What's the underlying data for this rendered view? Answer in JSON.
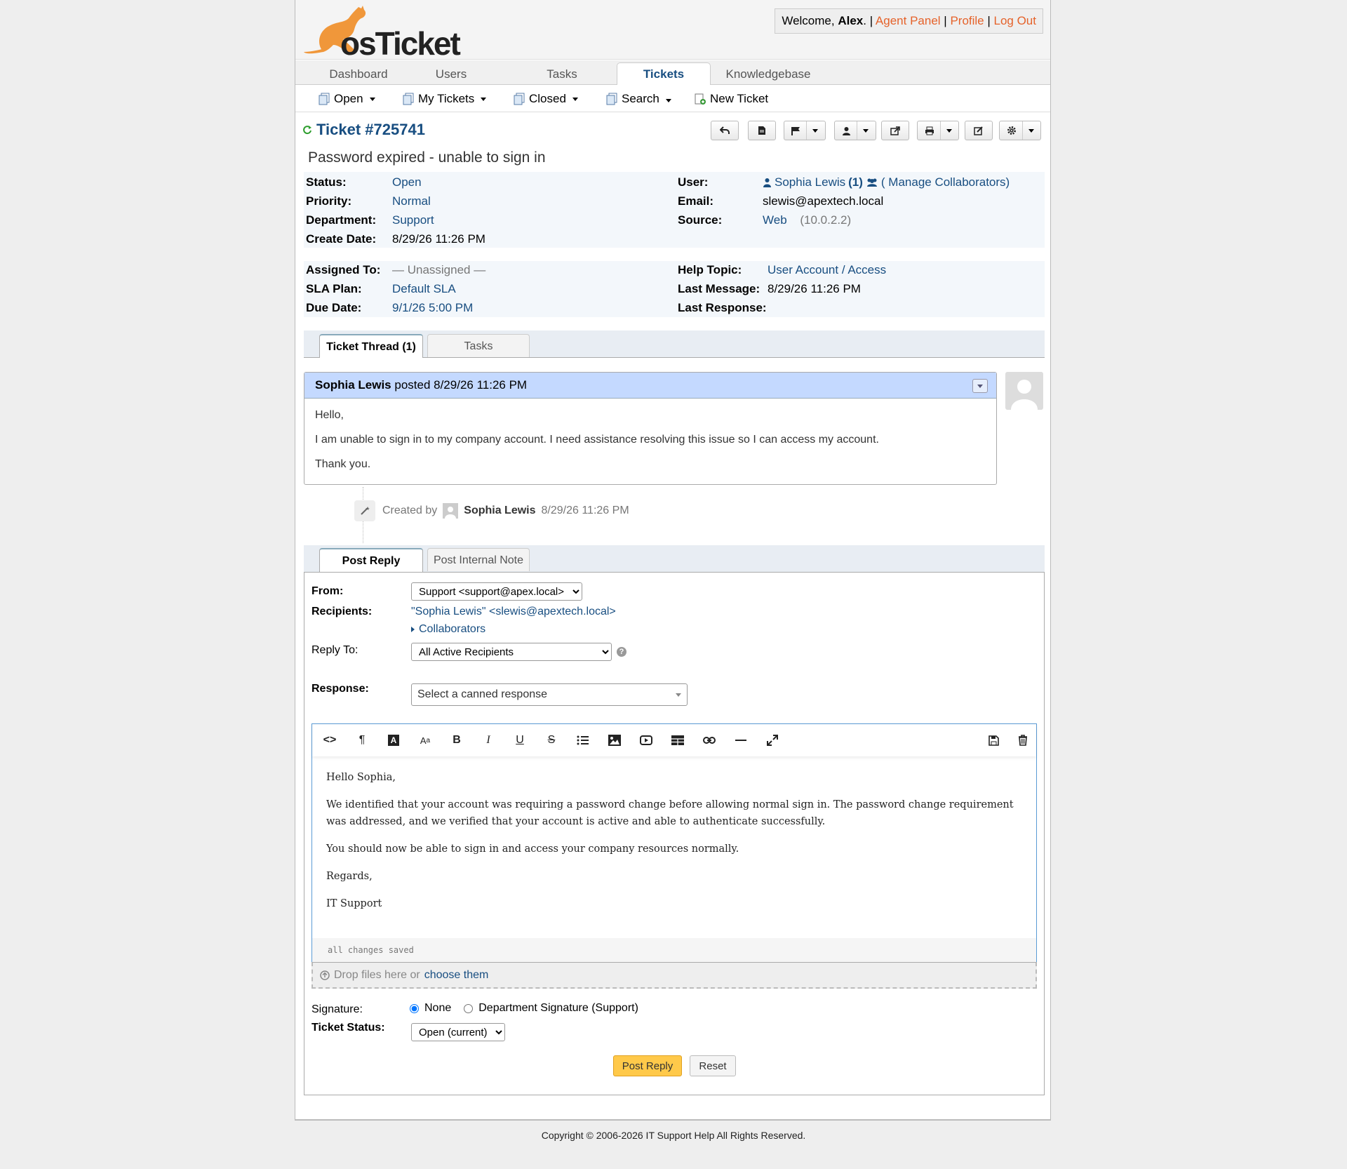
{
  "welcome": {
    "prefix": "Welcome, ",
    "name": "Alex",
    "suffix": ".",
    "agent_panel": "Agent Panel",
    "profile": "Profile",
    "logout": "Log Out"
  },
  "nav": {
    "tabs": [
      "Dashboard",
      "Users",
      "Tasks",
      "Tickets",
      "Knowledgebase"
    ]
  },
  "subnav": {
    "open": "Open",
    "my_tickets": "My Tickets",
    "closed": "Closed",
    "search": "Search",
    "new_ticket": "New Ticket"
  },
  "ticket": {
    "title": "Ticket #725741",
    "subject": "Password expired - unable to sign in",
    "status_label": "Status:",
    "status": "Open",
    "priority_label": "Priority:",
    "priority": "Normal",
    "department_label": "Department:",
    "department": "Support",
    "create_label": "Create Date:",
    "create_date": "8/29/26 11:26 PM",
    "user_label": "User:",
    "user": "Sophia Lewis",
    "user_count": "(1)",
    "manage": "( Manage Collaborators)",
    "email_label": "Email:",
    "email": "slewis@apextech.local",
    "source_label": "Source:",
    "source": "Web",
    "source_ip": "(10.0.2.2)",
    "assigned_label": "Assigned To:",
    "assigned": "— Unassigned —",
    "sla_label": "SLA Plan:",
    "sla": "Default SLA",
    "due_label": "Due Date:",
    "due": "9/1/26 5:00 PM",
    "help_label": "Help Topic:",
    "help_topic": "User Account / Access",
    "last_msg_label": "Last Message:",
    "last_msg": "8/29/26 11:26 PM",
    "last_resp_label": "Last Response:",
    "last_resp": ""
  },
  "thread_tabs": {
    "thread": "Ticket Thread (1)",
    "tasks": "Tasks"
  },
  "message": {
    "author": "Sophia Lewis",
    "posted": " posted 8/29/26 11:26 PM",
    "lines": [
      "Hello,",
      "I am unable to sign in to my company account. I need assistance resolving this issue so I can access my account.",
      "Thank you."
    ]
  },
  "event": {
    "prefix": "Created by",
    "author": "Sophia Lewis",
    "date": "8/29/26 11:26 PM"
  },
  "reply_tabs": {
    "post_reply": "Post Reply",
    "internal_note": "Post Internal Note"
  },
  "reply": {
    "from_label": "From:",
    "from_value": "Support <support@apex.local>",
    "recipients_label": "Recipients:",
    "recipients": "\"Sophia Lewis\" <slewis@apextech.local>",
    "collaborators": "Collaborators",
    "reply_to_label": "Reply To:",
    "reply_to": "All Active Recipients",
    "response_label": "Response:",
    "response_placeholder": "Select a canned response",
    "body": [
      "Hello Sophia,",
      "We identified that your account was requiring a password change before allowing normal sign in. The password change requirement was addressed, and we verified that your account is active and able to authenticate successfully.",
      "You should now be able to sign in and access your company resources normally.",
      "Regards,",
      "IT Support"
    ],
    "status_text": "all changes saved",
    "drop_text": "Drop files here or",
    "drop_link": "choose them",
    "signature_label": "Signature:",
    "sig_none": "None",
    "sig_dept": "Department Signature (Support)",
    "ticket_status_label": "Ticket Status:",
    "ticket_status": "Open (current)",
    "post_button": "Post Reply",
    "reset_button": "Reset"
  },
  "footer": "Copyright © 2006-2026 IT Support Help All Rights Reserved.",
  "colors": {
    "accent": "#184e81",
    "orange": "#e5622a",
    "thread_head": "#c4d9ff",
    "post_button": "#ffc94a"
  }
}
